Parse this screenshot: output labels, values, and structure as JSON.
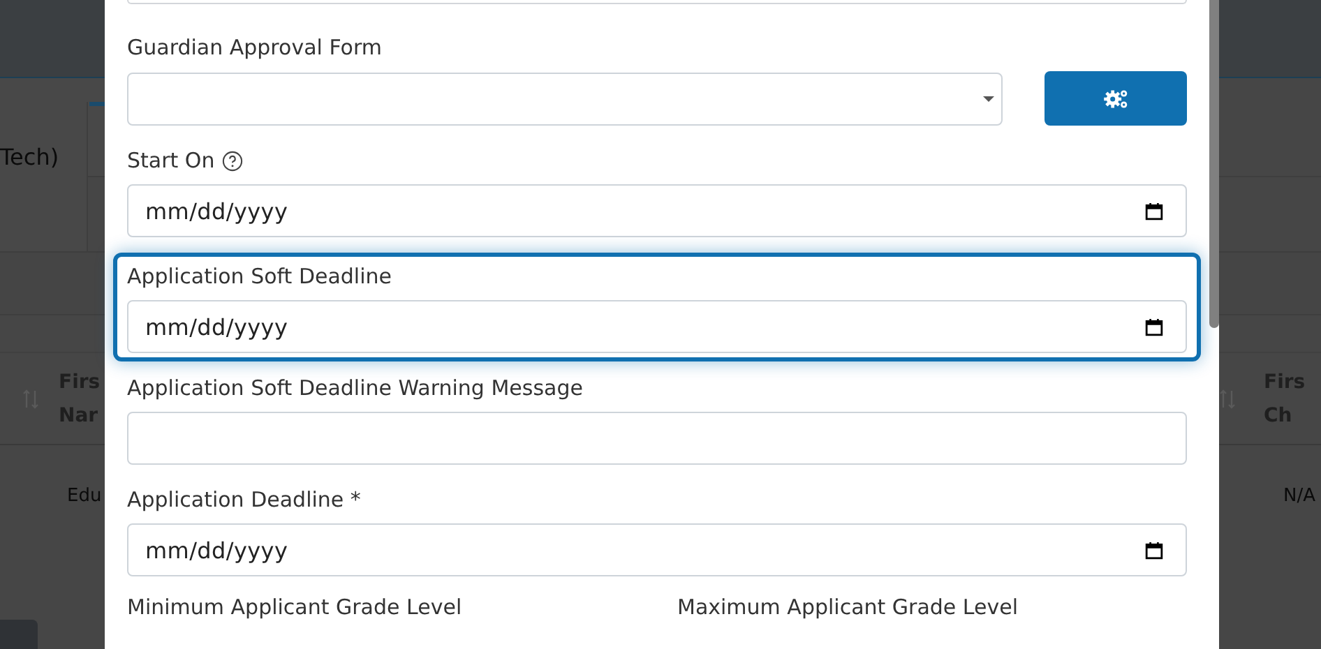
{
  "background": {
    "tab_label": "Tech)",
    "left_column": {
      "header_lines": [
        "Firs",
        "Nar"
      ],
      "cell": "Edu"
    },
    "right_column": {
      "header_lines": [
        "Firs",
        "Ch"
      ],
      "cell": "N/A"
    }
  },
  "modal": {
    "fields": [
      {
        "kind": "select",
        "label": "Guardian Approval Form",
        "help_icon": false,
        "focused": false
      },
      {
        "kind": "date",
        "label": "Start On",
        "placeholder": "mm/dd/yyyy",
        "help_icon": true,
        "focused": false
      },
      {
        "kind": "date",
        "label": "Application Soft Deadline",
        "placeholder": "mm/dd/yyyy",
        "help_icon": false,
        "focused": true
      },
      {
        "kind": "text",
        "label": "Application Soft Deadline Warning Message",
        "help_icon": false,
        "focused": false
      },
      {
        "kind": "date",
        "label": "Application Deadline *",
        "placeholder": "mm/dd/yyyy",
        "help_icon": false,
        "focused": false
      }
    ],
    "grade_labels": [
      "Minimum Applicant Grade Level",
      "Maximum Applicant Grade Level"
    ]
  }
}
